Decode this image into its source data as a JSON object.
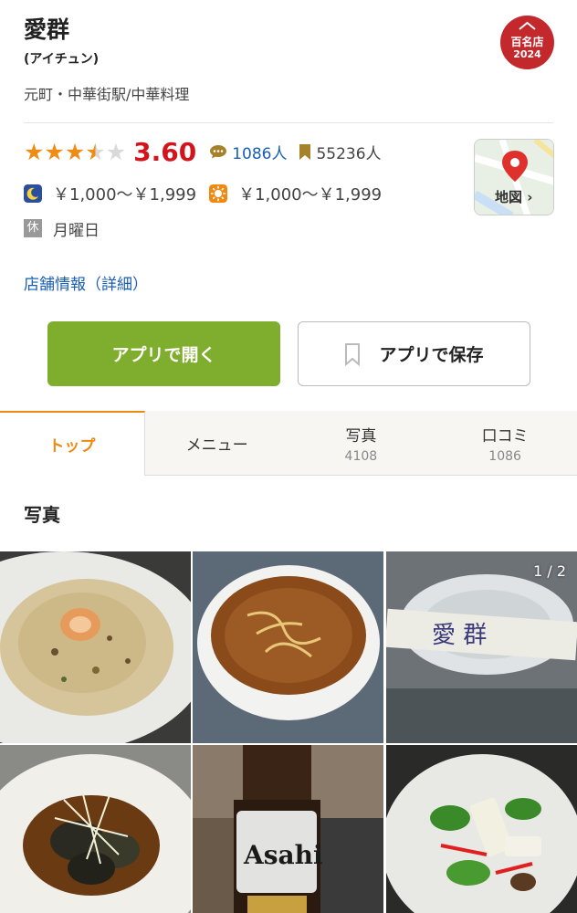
{
  "shop": {
    "name": "愛群",
    "kana": "(アイチュン)",
    "area": "元町・中華街駅/中華料理"
  },
  "badge": {
    "line1": "百名店",
    "line2": "2024"
  },
  "rating": {
    "stars": 3.5,
    "score": "3.60",
    "reviews": "1086人",
    "saves": "55236人"
  },
  "prices": {
    "dinner": "￥1,000〜￥1,999",
    "lunch": "￥1,000〜￥1,999"
  },
  "holiday": {
    "icon_text": "休",
    "text": "月曜日"
  },
  "map": {
    "label": "地図 ›"
  },
  "detail_link": "店舗情報（詳細）",
  "buttons": {
    "open_app": "アプリで開く",
    "save_app": "アプリで保存"
  },
  "tabs": [
    {
      "label": "トップ",
      "sub": ""
    },
    {
      "label": "メニュー",
      "sub": ""
    },
    {
      "label": "写真",
      "sub": "4108"
    },
    {
      "label": "口コミ",
      "sub": "1086"
    }
  ],
  "section": {
    "photos_title": "写真"
  },
  "gallery": {
    "counter": "1 / 2"
  },
  "colors": {
    "accent_orange": "#ef8a10",
    "score_red": "#d3141c",
    "link_blue": "#1a5fb4",
    "open_button_green": "#7fad2d",
    "badge_red": "#c3282c"
  },
  "icons": [
    "moon-icon",
    "sun-icon",
    "review-bubble-icon",
    "bookmark-icon",
    "map-pin-icon"
  ]
}
